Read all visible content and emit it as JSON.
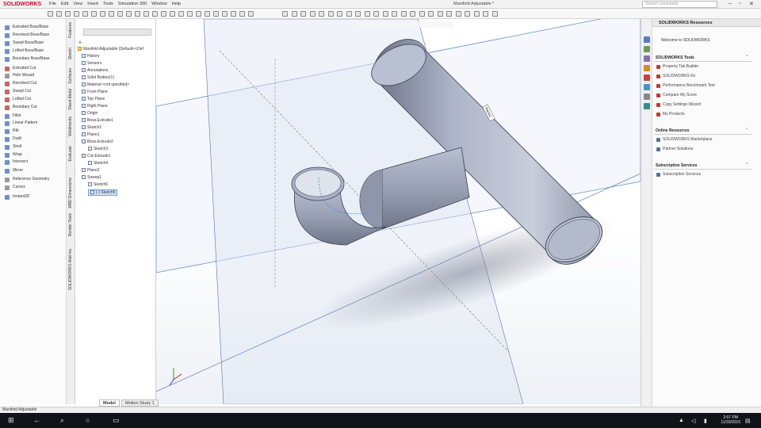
{
  "app": {
    "logo": "SOLIDWORKS",
    "window_title": "Manifold Adjustable *",
    "search_placeholder": "Search commands"
  },
  "menu": [
    "File",
    "Edit",
    "View",
    "Insert",
    "Tools",
    "Simulation 360",
    "Window",
    "Help"
  ],
  "features": [
    {
      "label": "Extruded Boss/Base",
      "color": "#6f8fc7"
    },
    {
      "label": "Revolved Boss/Base",
      "color": "#6f8fc7"
    },
    {
      "label": "Swept Boss/Base",
      "color": "#6f8fc7"
    },
    {
      "label": "Lofted Boss/Base",
      "color": "#6f8fc7"
    },
    {
      "label": "Boundary Boss/Base",
      "color": "#6f8fc7"
    },
    {
      "label": "Extruded Cut",
      "color": "#c86464"
    },
    {
      "label": "Hole Wizard",
      "color": "#9a9a9a"
    },
    {
      "label": "Revolved Cut",
      "color": "#c86464"
    },
    {
      "label": "Swept Cut",
      "color": "#c86464"
    },
    {
      "label": "Lofted Cut",
      "color": "#c86464"
    },
    {
      "label": "Boundary Cut",
      "color": "#c86464"
    },
    {
      "label": "Fillet",
      "color": "#6f8fc7"
    },
    {
      "label": "Linear Pattern",
      "color": "#6f8fc7"
    },
    {
      "label": "Rib",
      "color": "#6f8fc7"
    },
    {
      "label": "Draft",
      "color": "#6f8fc7"
    },
    {
      "label": "Shell",
      "color": "#6f8fc7"
    },
    {
      "label": "Wrap",
      "color": "#6f8fc7"
    },
    {
      "label": "Intersect",
      "color": "#6f8fc7"
    },
    {
      "label": "Mirror",
      "color": "#6f8fc7"
    },
    {
      "label": "Reference Geometry",
      "color": "#9a9a9a"
    },
    {
      "label": "Curves",
      "color": "#9a9a9a"
    },
    {
      "label": "Instant3D",
      "color": "#6f8fc7"
    }
  ],
  "vertical_tabs": [
    "Features",
    "Sketch",
    "Surfaces",
    "Sheet Metal",
    "Weldments",
    "Evaluate",
    "MBD Dimensions",
    "Render Tools",
    "SOLIDWORKS Add-Ins"
  ],
  "tree": {
    "root": "Manifold Adjustable  (Default<<Def",
    "items": [
      {
        "label": "History",
        "indent": 1
      },
      {
        "label": "Sensors",
        "indent": 1
      },
      {
        "label": "Annotations",
        "indent": 1
      },
      {
        "label": "Solid Bodies(1)",
        "indent": 1
      },
      {
        "label": "Material <not specified>",
        "indent": 1
      },
      {
        "label": "Front Plane",
        "indent": 1
      },
      {
        "label": "Top Plane",
        "indent": 1
      },
      {
        "label": "Right Plane",
        "indent": 1
      },
      {
        "label": "Origin",
        "indent": 1
      },
      {
        "label": "Boss-Extrude1",
        "indent": 1
      },
      {
        "label": "Sketch2",
        "indent": 1
      },
      {
        "label": "Plane1",
        "indent": 1
      },
      {
        "label": "Boss-Extrude2",
        "indent": 1
      },
      {
        "label": "Sketch3",
        "indent": 2
      },
      {
        "label": "Cut-Extrude1",
        "indent": 1
      },
      {
        "label": "Sketch4",
        "indent": 2
      },
      {
        "label": "Plane2",
        "indent": 1
      },
      {
        "label": "Sweep1",
        "indent": 1
      },
      {
        "label": "Sketch6",
        "indent": 2
      },
      {
        "label": "(-) Sketch5",
        "indent": 2,
        "selected": true
      }
    ]
  },
  "viewport": {
    "plane_label": "Plane2"
  },
  "bottom_tabs": [
    "Model",
    "Motion Study 1"
  ],
  "status": "Manifold Adjustable",
  "taskpane": {
    "header": "SOLIDWORKS Resources",
    "welcome": "Welcome to SOLIDWORKS",
    "sections": [
      {
        "title": "SOLIDWORKS Tools",
        "items": [
          "Property Tab Builder",
          "SOLIDWORKS Rx",
          "Performance Benchmark Test",
          "Compare My Score",
          "Copy Settings Wizard",
          "My Products"
        ]
      },
      {
        "title": "Online Resources",
        "items": [
          "SOLIDWORKS Marketplace",
          "Partner Solutions"
        ]
      },
      {
        "title": "Subscription Services",
        "items": [
          "Subscription Services"
        ]
      }
    ]
  },
  "taskbar": {
    "time": "2:07 PM",
    "date": "11/30/2016"
  }
}
